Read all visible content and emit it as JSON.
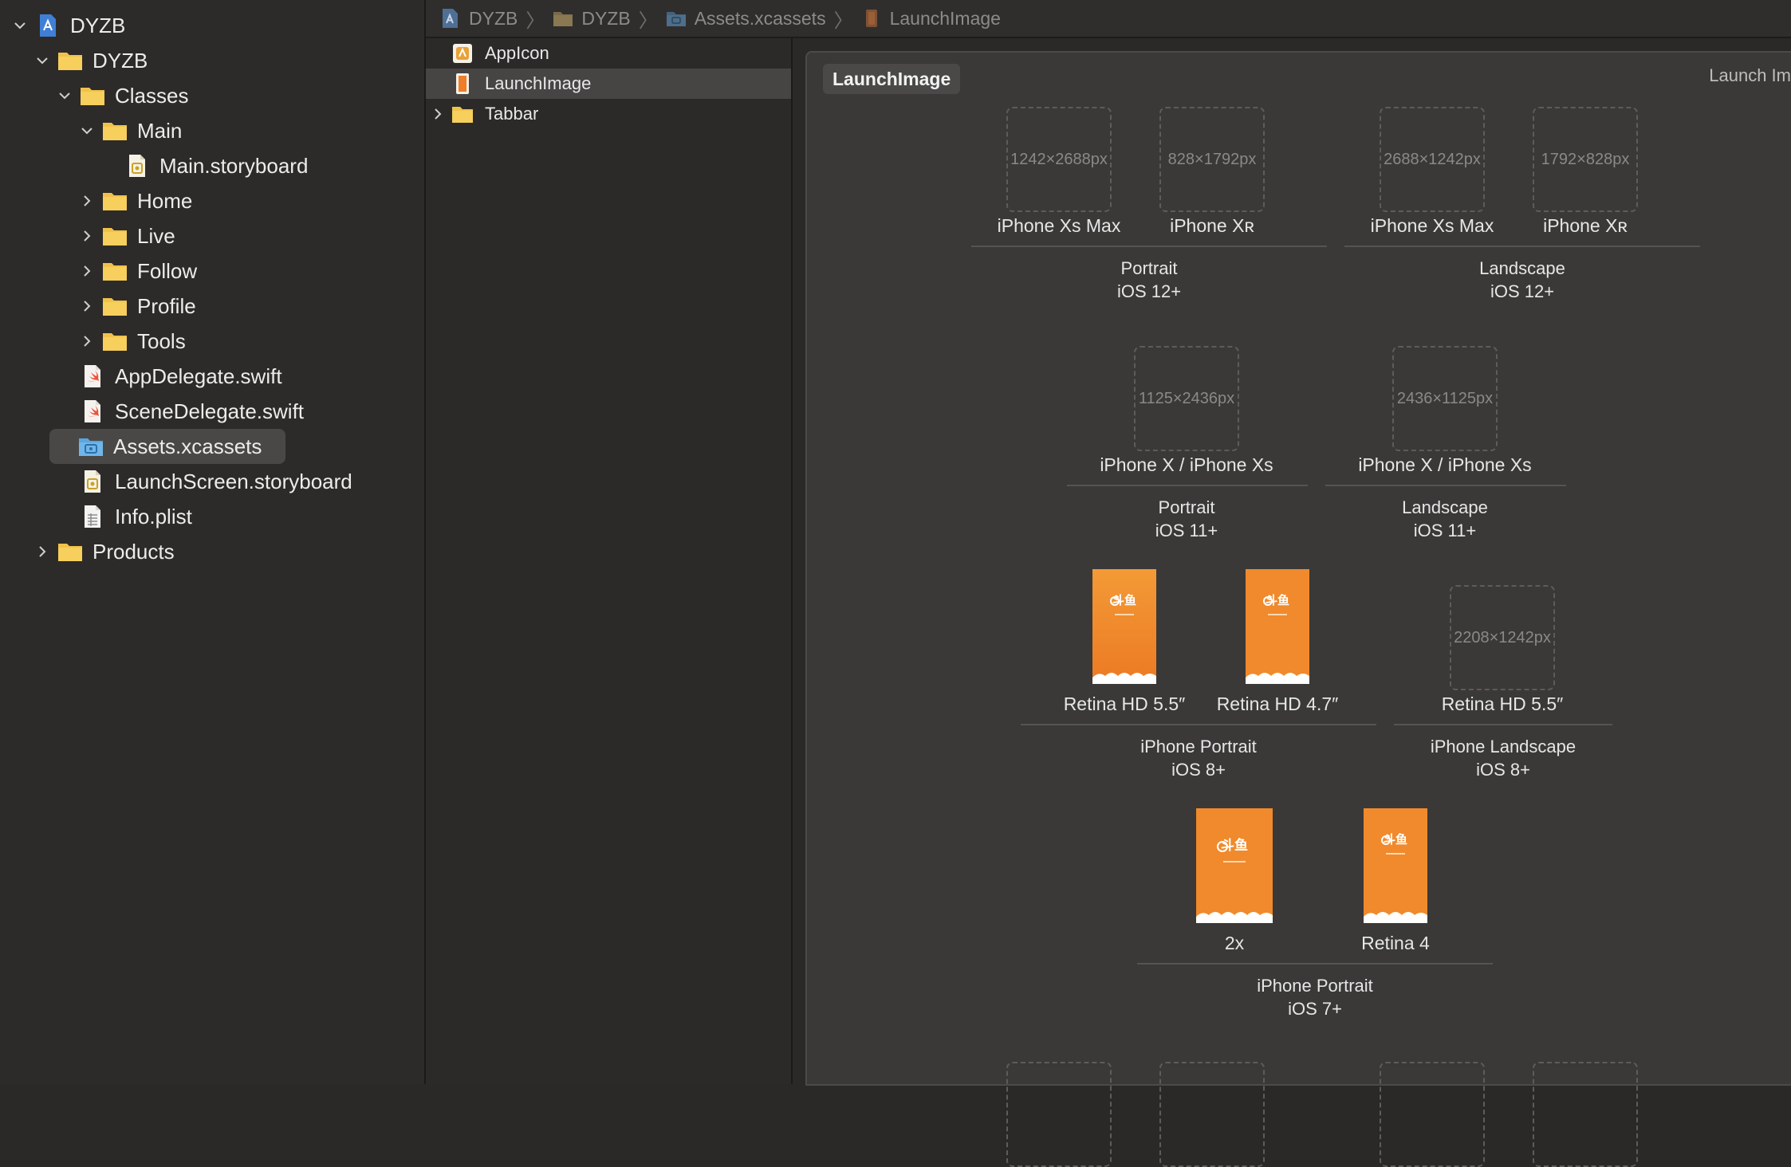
{
  "navigator": {
    "items": [
      {
        "label": "DYZB",
        "kind": "project",
        "chevron": "down"
      },
      {
        "label": "DYZB",
        "kind": "folder",
        "chevron": "down"
      },
      {
        "label": "Classes",
        "kind": "folder",
        "chevron": "down"
      },
      {
        "label": "Main",
        "kind": "folder",
        "chevron": "down"
      },
      {
        "label": "Main.storyboard",
        "kind": "storyboard",
        "chevron": "none"
      },
      {
        "label": "Home",
        "kind": "folder",
        "chevron": "right"
      },
      {
        "label": "Live",
        "kind": "folder",
        "chevron": "right"
      },
      {
        "label": "Follow",
        "kind": "folder",
        "chevron": "right"
      },
      {
        "label": "Profile",
        "kind": "folder",
        "chevron": "right"
      },
      {
        "label": "Tools",
        "kind": "folder",
        "chevron": "right"
      },
      {
        "label": "AppDelegate.swift",
        "kind": "swift",
        "chevron": "none"
      },
      {
        "label": "SceneDelegate.swift",
        "kind": "swift",
        "chevron": "none"
      },
      {
        "label": "Assets.xcassets",
        "kind": "xcassets",
        "chevron": "none",
        "selected": true
      },
      {
        "label": "LaunchScreen.storyboard",
        "kind": "storyboard",
        "chevron": "none"
      },
      {
        "label": "Info.plist",
        "kind": "plist",
        "chevron": "none"
      },
      {
        "label": "Products",
        "kind": "folder",
        "chevron": "right"
      }
    ]
  },
  "jumpbar": {
    "crumbs": [
      {
        "label": "DYZB",
        "icon": "project-icon"
      },
      {
        "label": "DYZB",
        "icon": "folder-icon"
      },
      {
        "label": "Assets.xcassets",
        "icon": "xcassets-icon"
      },
      {
        "label": "LaunchImage",
        "icon": "launchimage-icon"
      }
    ]
  },
  "assets": {
    "items": [
      {
        "label": "AppIcon",
        "kind": "appicon",
        "chevron": false
      },
      {
        "label": "LaunchImage",
        "kind": "launchimage",
        "chevron": false,
        "selected": true
      },
      {
        "label": "Tabbar",
        "kind": "folder",
        "chevron": true
      }
    ]
  },
  "editor": {
    "set_name": "LaunchImage",
    "set_kind": "Launch Im",
    "slots": [
      {
        "size": "1242×2688px",
        "label": "iPhone Xs Max",
        "filled": false
      },
      {
        "size": "828×1792px",
        "label": "iPhone Xʀ",
        "filled": false
      },
      {
        "size": "2688×1242px",
        "label": "iPhone Xs Max",
        "filled": false
      },
      {
        "size": "1792×828px",
        "label": "iPhone Xʀ",
        "filled": false
      },
      {
        "size": "1125×2436px",
        "label": "iPhone X / iPhone Xs",
        "filled": false
      },
      {
        "size": "2436×1125px",
        "label": "iPhone X / iPhone Xs",
        "filled": false
      },
      {
        "size": "",
        "label": "Retina HD 5.5″",
        "filled": true
      },
      {
        "size": "",
        "label": "Retina HD 4.7″",
        "filled": true
      },
      {
        "size": "2208×1242px",
        "label": "Retina HD 5.5″",
        "filled": false
      },
      {
        "size": "",
        "label": "2x",
        "filled": true
      },
      {
        "size": "",
        "label": "Retina 4",
        "filled": true
      }
    ],
    "groups": [
      {
        "line1": "Portrait",
        "line2": "iOS 12+"
      },
      {
        "line1": "Landscape",
        "line2": "iOS 12+"
      },
      {
        "line1": "Portrait",
        "line2": "iOS 11+"
      },
      {
        "line1": "Landscape",
        "line2": "iOS 11+"
      },
      {
        "line1": "iPhone Portrait",
        "line2": "iOS 8+"
      },
      {
        "line1": "iPhone Landscape",
        "line2": "iOS 8+"
      },
      {
        "line1": "iPhone Portrait",
        "line2": "iOS 7+"
      }
    ]
  },
  "colors": {
    "folder": "#f0c24a",
    "project": "#3f7fd6",
    "swift": "#f05138",
    "launch_orange": "#f08a2c",
    "selection": "#4a4847"
  }
}
